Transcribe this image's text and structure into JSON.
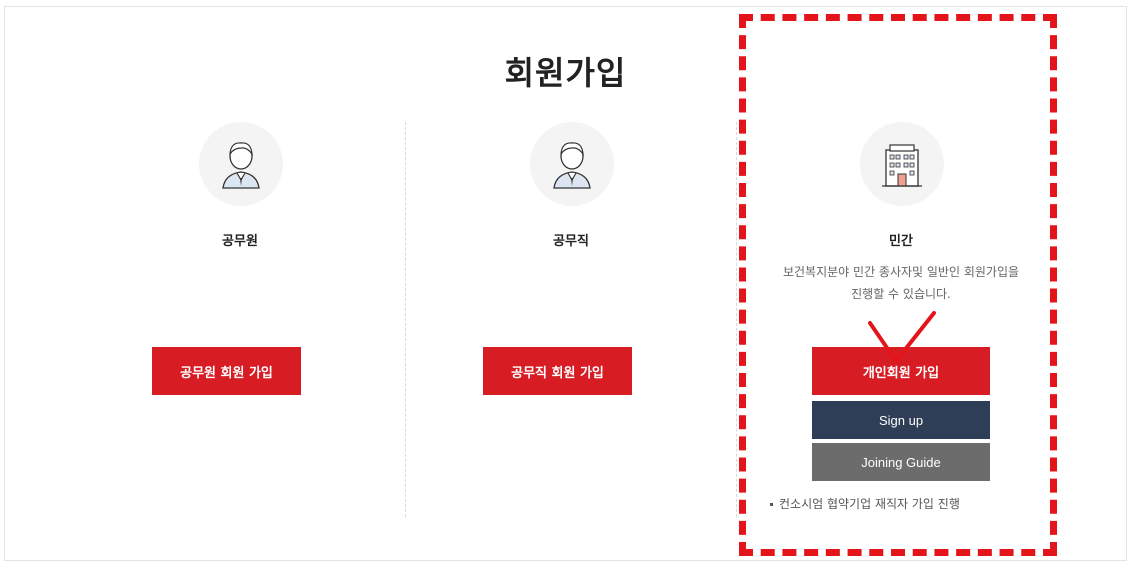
{
  "page": {
    "title": "회원가입"
  },
  "columns": [
    {
      "label": "공무원",
      "icon": "person-icon",
      "button": "공무원 회원 가입"
    },
    {
      "label": "공무직",
      "icon": "person-icon",
      "button": "공무직 회원 가입"
    },
    {
      "label": "민간",
      "icon": "building-icon",
      "description_line1": "보건복지분야 민간 종사자및 일반인 회원가입을",
      "description_line2": "진행할 수 있습니다.",
      "button": "개인회원 가입",
      "signup_button": "Sign up",
      "guide_button": "Joining Guide",
      "note": "컨소시엄 협약기업 재직자 가입 진행"
    }
  ],
  "colors": {
    "primary_red": "#d81c24",
    "navy": "#2d3e56",
    "gray": "#6c6c6c",
    "highlight": "#e4141b"
  }
}
